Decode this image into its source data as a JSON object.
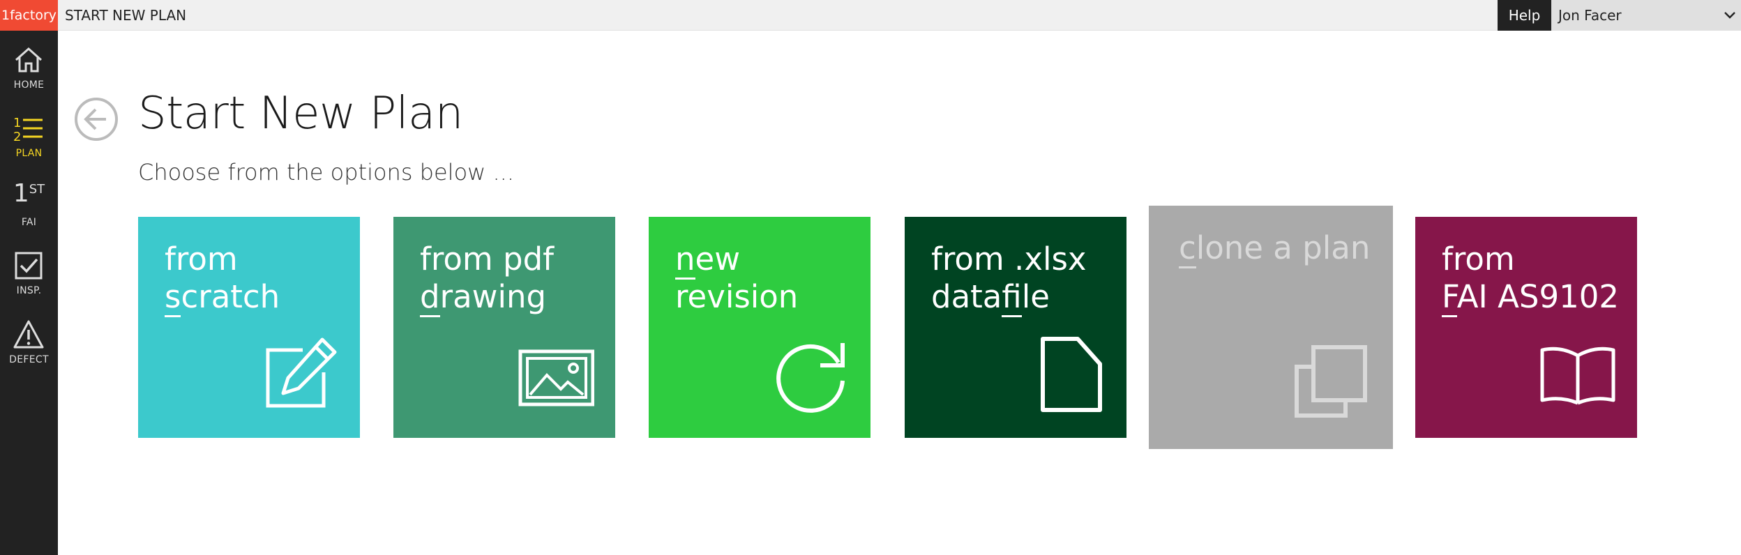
{
  "topbar": {
    "brand": "1factory",
    "page_label": "START NEW PLAN",
    "help_label": "Help",
    "user_name": "Jon Facer"
  },
  "sidebar": {
    "items": [
      {
        "label": "HOME",
        "icon": "home-icon",
        "active": false
      },
      {
        "label": "PLAN",
        "icon": "numbered-list-icon",
        "active": true
      },
      {
        "label": "FAI",
        "icon": "first-icon",
        "active": false,
        "glyph_num": "1",
        "glyph_sup": "ST"
      },
      {
        "label": "INSP.",
        "icon": "checkbox-icon",
        "active": false
      },
      {
        "label": "DEFECT",
        "icon": "warning-icon",
        "active": false
      }
    ]
  },
  "main": {
    "title": "Start New Plan",
    "subtitle": "Choose from the options below ..."
  },
  "tiles": [
    {
      "line1_pre": "from",
      "line1_u": "",
      "line1_post": "",
      "line2_pre": "",
      "line2_u": "s",
      "line2_post": "cratch",
      "color": "#3cc9cc",
      "icon": "edit-pencil-icon",
      "enabled": true
    },
    {
      "line1_pre": "from pdf",
      "line1_u": "",
      "line1_post": "",
      "line2_pre": "",
      "line2_u": "d",
      "line2_post": "rawing",
      "color": "#3e9872",
      "icon": "image-icon",
      "enabled": true
    },
    {
      "line1_pre": "",
      "line1_u": "n",
      "line1_post": "ew",
      "line2_pre": "revision",
      "line2_u": "",
      "line2_post": "",
      "color": "#2ecc40",
      "icon": "refresh-icon",
      "enabled": true
    },
    {
      "line1_pre": "from .xlsx",
      "line1_u": "",
      "line1_post": "",
      "line2_pre": "data",
      "line2_u": "fi",
      "line2_post": "le",
      "color": "#004422",
      "icon": "file-icon",
      "enabled": true
    },
    {
      "line1_pre": "",
      "line1_u": "c",
      "line1_post": "lone a plan",
      "line2_pre": "",
      "line2_u": "",
      "line2_post": "",
      "color": "#aaaaaa",
      "icon": "copy-icon",
      "enabled": false
    },
    {
      "line1_pre": "from",
      "line1_u": "",
      "line1_post": "",
      "line2_pre": "",
      "line2_u": "F",
      "line2_post": "AI AS9102",
      "color": "#86164a",
      "icon": "book-icon",
      "enabled": true
    }
  ]
}
